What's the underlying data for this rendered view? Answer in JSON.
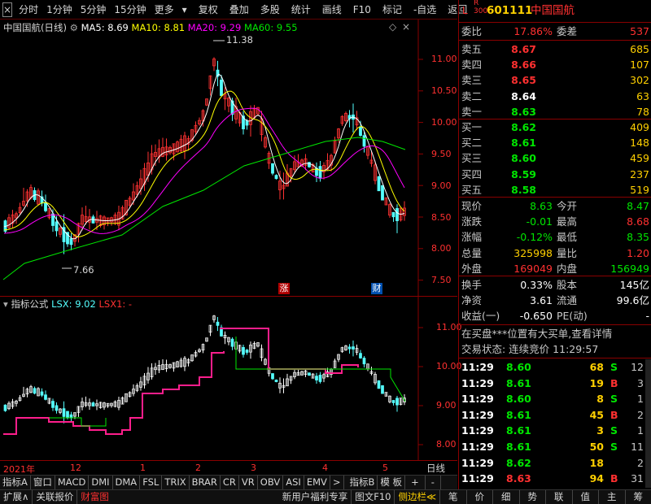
{
  "toolbar": {
    "close": "×",
    "left_items": [
      "分时",
      "1分钟",
      "5分钟",
      "15分钟",
      "更多"
    ],
    "right_items": [
      "复权",
      "叠加",
      "多股",
      "统计",
      "画线",
      "F10",
      "标记",
      "-自选",
      "返回"
    ]
  },
  "main_chart": {
    "stock_label": "中国国航(日线)",
    "ma5": "MA5: 8.69",
    "ma10": "MA10: 8.81",
    "ma20": "MA20: 9.29",
    "ma60": "MA60: 9.55",
    "high_label": "11.38",
    "low_label": "7.66",
    "y_ticks": [
      "11.00",
      "10.50",
      "10.00",
      "9.50",
      "9.00",
      "8.50",
      "8.00",
      "7.50"
    ],
    "marker_up": "涨",
    "marker_fin": "财",
    "colors": {
      "ma5": "#ffffff",
      "ma10": "#ffff00",
      "ma20": "#ff00ff",
      "ma60": "#00e600",
      "up": "#ff3232",
      "down": "#54ffff"
    }
  },
  "sub_chart": {
    "title": "指标公式",
    "lsx": "LSX: 9.02",
    "lsx1": "LSX1: -",
    "y_ticks": [
      "11.00",
      "10.00",
      "9.00",
      "8.00"
    ]
  },
  "x_axis": {
    "labels": [
      "2021年",
      "12",
      "1",
      "2",
      "3",
      "4",
      "5"
    ],
    "period": "日线"
  },
  "tabs": [
    "指标A",
    "窗口",
    "MACD",
    "DMI",
    "DMA",
    "FSL",
    "TRIX",
    "BRAR",
    "CR",
    "VR",
    "OBV",
    "ASI",
    "EMV",
    ">",
    "指标B",
    "模 板",
    "+",
    "-"
  ],
  "bottom_bar": {
    "left": [
      "扩展∧",
      "关联报价",
      "财富图"
    ],
    "right": [
      "新用户福利专享",
      "图文F10",
      "侧边栏≪"
    ],
    "nav": [
      "笔",
      "价",
      "细",
      "势",
      "联",
      "值",
      "主",
      "筹"
    ]
  },
  "quote": {
    "lr": "L",
    "r300": "R\n300",
    "code": "601111",
    "name": "中国国航",
    "weibi_label": "委比",
    "weibi": "17.86%",
    "weicha_label": "委差",
    "weicha": "537",
    "asks": [
      {
        "label": "卖五",
        "price": "8.67",
        "vol": "685"
      },
      {
        "label": "卖四",
        "price": "8.66",
        "vol": "107"
      },
      {
        "label": "卖三",
        "price": "8.65",
        "vol": "302"
      },
      {
        "label": "卖二",
        "price": "8.64",
        "vol": "63"
      },
      {
        "label": "卖一",
        "price": "8.63",
        "vol": "78"
      }
    ],
    "bids": [
      {
        "label": "买一",
        "price": "8.62",
        "vol": "409"
      },
      {
        "label": "买二",
        "price": "8.61",
        "vol": "148"
      },
      {
        "label": "买三",
        "price": "8.60",
        "vol": "459"
      },
      {
        "label": "买四",
        "price": "8.59",
        "vol": "237"
      },
      {
        "label": "买五",
        "price": "8.58",
        "vol": "519"
      }
    ],
    "stats": [
      {
        "l1": "现价",
        "v1": "8.63",
        "l2": "今开",
        "v2": "8.47"
      },
      {
        "l1": "涨跌",
        "v1": "-0.01",
        "l2": "最高",
        "v2": "8.68"
      },
      {
        "l1": "涨幅",
        "v1": "-0.12%",
        "l2": "最低",
        "v2": "8.35"
      },
      {
        "l1": "总量",
        "v1": "325998",
        "l2": "量比",
        "v2": "1.20"
      },
      {
        "l1": "外盘",
        "v1": "169049",
        "l2": "内盘",
        "v2": "156949"
      }
    ],
    "stats2": [
      {
        "l1": "换手",
        "v1": "0.33%",
        "l2": "股本",
        "v2": "145亿"
      },
      {
        "l1": "净资",
        "v1": "3.61",
        "l2": "流通",
        "v2": "99.6亿"
      },
      {
        "l1": "收益(一)",
        "v1": "-0.650",
        "l2": "PE(动)",
        "v2": "-"
      }
    ],
    "notice": "在买盘***位置有大买单,查看详情",
    "trade_status": "交易状态: 连续竞价 11:29:57",
    "ticks": [
      {
        "t": "11:29",
        "p": "8.60",
        "v": "68",
        "bs": "S",
        "n": "12"
      },
      {
        "t": "11:29",
        "p": "8.61",
        "v": "19",
        "bs": "B",
        "n": "3"
      },
      {
        "t": "11:29",
        "p": "8.60",
        "v": "8",
        "bs": "S",
        "n": "1"
      },
      {
        "t": "11:29",
        "p": "8.61",
        "v": "45",
        "bs": "B",
        "n": "2"
      },
      {
        "t": "11:29",
        "p": "8.61",
        "v": "3",
        "bs": "S",
        "n": "1"
      },
      {
        "t": "11:29",
        "p": "8.61",
        "v": "50",
        "bs": "S",
        "n": "11"
      },
      {
        "t": "11:29",
        "p": "8.62",
        "v": "18",
        "bs": "",
        "n": "2"
      },
      {
        "t": "11:29",
        "p": "8.63",
        "v": "94",
        "bs": "B",
        "n": "31"
      }
    ]
  }
}
